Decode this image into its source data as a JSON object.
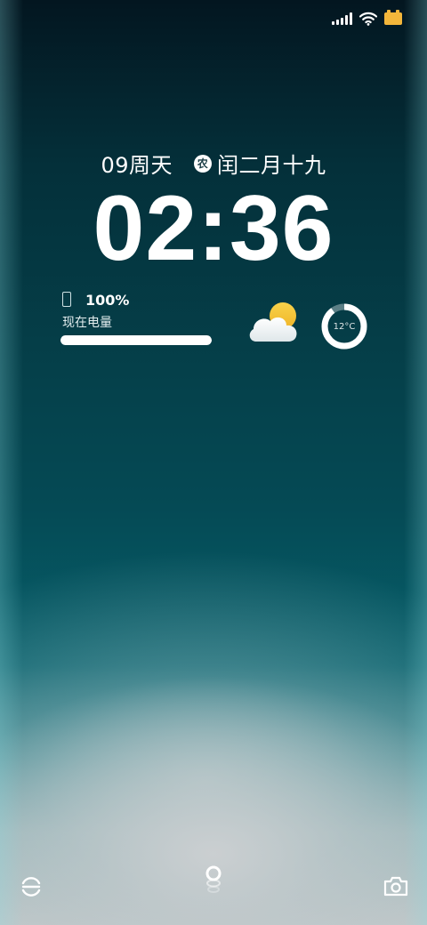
{
  "status_bar": {
    "signal_icon": "cellular-signal-icon",
    "wifi_icon": "wifi-icon",
    "battery_icon": "battery-status-icon",
    "battery_color": "#f3b63b"
  },
  "date": {
    "day_weekday": "09周天",
    "lunar_badge": "农",
    "lunar_date": "闰二月十九"
  },
  "clock": {
    "time": "02:36"
  },
  "battery_widget": {
    "icon": "phone-icon",
    "percent_text": "100%",
    "label": "现在电量",
    "level": 1.0
  },
  "weather": {
    "icon": "partly-cloudy-icon"
  },
  "temperature": {
    "text": "12°C",
    "ring_progress": 0.9
  },
  "bottom": {
    "left_icon": "smart-assistant-icon",
    "center_icon": "unlock-indicator-icon",
    "right_icon": "camera-icon"
  }
}
